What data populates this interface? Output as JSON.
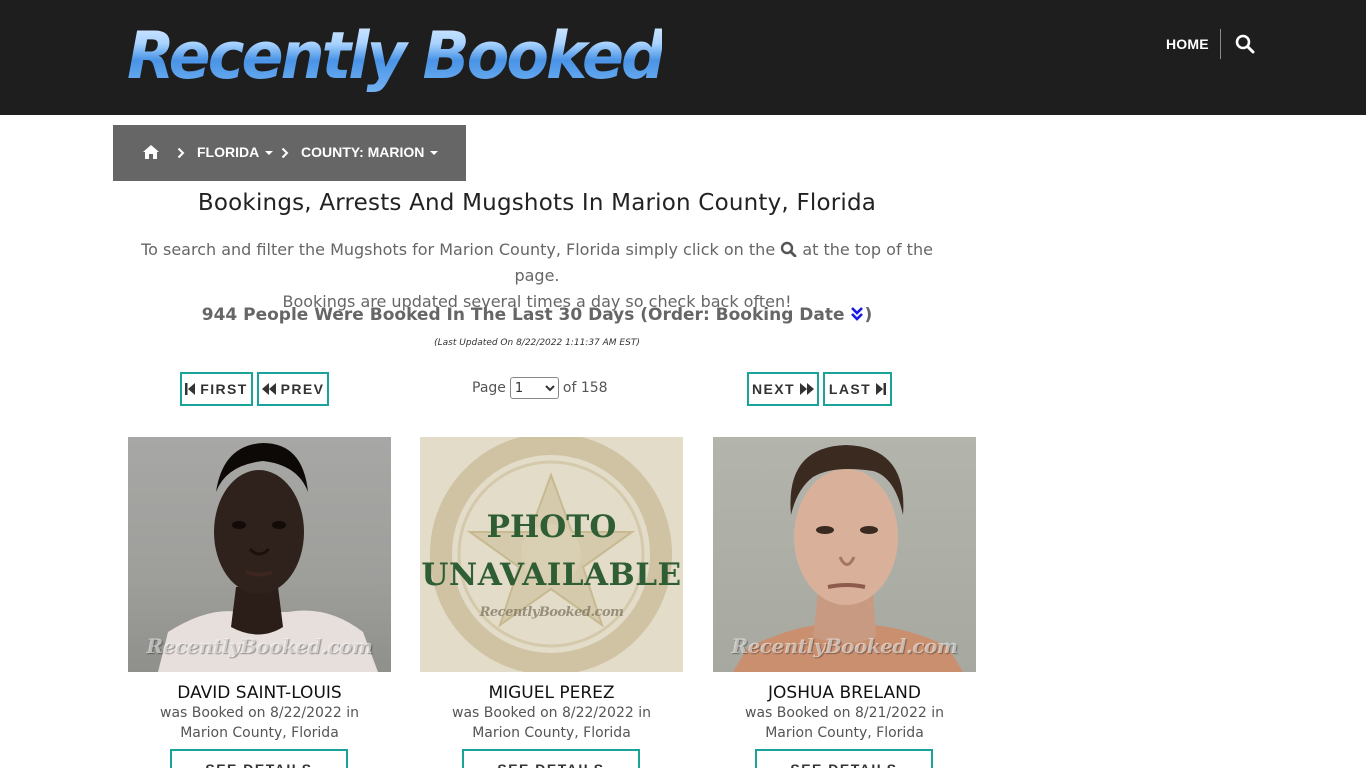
{
  "header": {
    "logo_text": "Recently Booked",
    "nav_home": "HOME",
    "search_icon": "search-icon"
  },
  "breadcrumb": {
    "home_icon": "home-icon",
    "state": "FLORIDA",
    "county": "COUNTY: MARION"
  },
  "main": {
    "headline": "Bookings, Arrests And Mugshots In Marion County, Florida",
    "intro_part1": "To search and filter the Mugshots for Marion County, Florida simply click on the",
    "intro_part2": "at the top of the page.",
    "intro_line2": "Bookings are updated several times a day so check back often!",
    "count_text": "944 People Were Booked In The Last 30 Days (Order: Booking Date",
    "count_close": ")",
    "last_updated": "(Last Updated On 8/22/2022 1:11:37 AM EST)"
  },
  "pager": {
    "first": "FIRST",
    "prev": "PREV",
    "next": "NEXT",
    "last": "LAST",
    "page_label": "Page",
    "current_page": "1",
    "of_label": "of 158"
  },
  "cards": [
    {
      "name": "DAVID SAINT-LOUIS",
      "booked": "was Booked on 8/22/2022 in",
      "location": "Marion County, Florida",
      "button": "SEE DETAILS",
      "watermark": "RecentlyBooked.com"
    },
    {
      "name": "MIGUEL PEREZ",
      "booked": "was Booked on 8/22/2022 in",
      "location": "Marion County, Florida",
      "button": "SEE DETAILS",
      "placeholder_line1": "PHOTO",
      "placeholder_line2": "UNAVAILABLE",
      "watermark": "RecentlyBooked.com"
    },
    {
      "name": "JOSHUA BRELAND",
      "booked": "was Booked on 8/21/2022 in",
      "location": "Marion County, Florida",
      "button": "SEE DETAILS",
      "watermark": "RecentlyBooked.com"
    }
  ],
  "colors": {
    "header_bg": "#1e1e1e",
    "breadcrumb_bg": "#666666",
    "accent_teal": "#1aa39a",
    "sort_icon_blue": "#1a1adf"
  }
}
